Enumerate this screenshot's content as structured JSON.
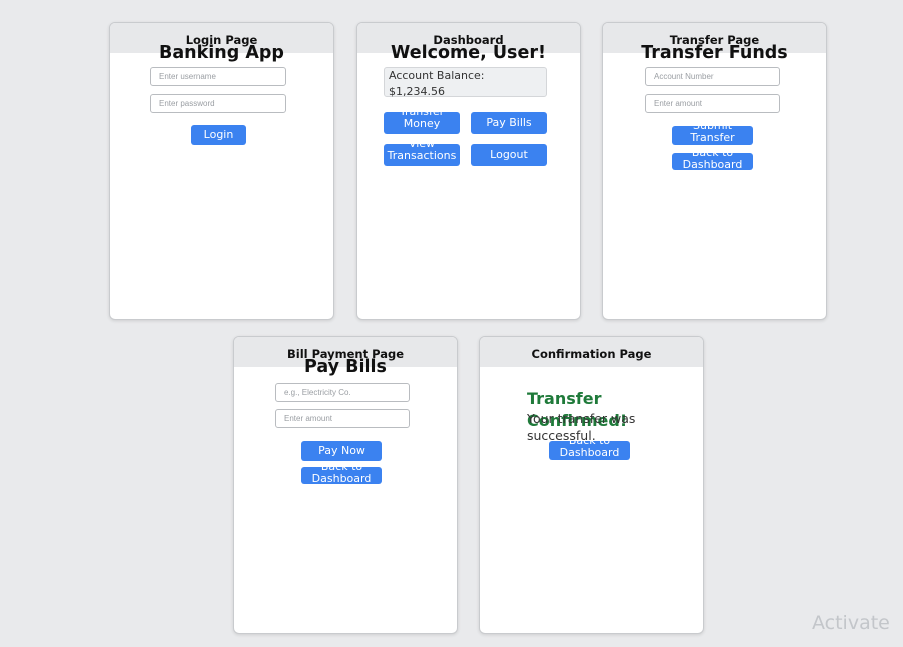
{
  "login": {
    "page_label": "Login Page",
    "heading": "Banking App",
    "username_placeholder": "Enter username",
    "password_placeholder": "Enter password",
    "login_button": "Login"
  },
  "dashboard": {
    "page_label": "Dashboard",
    "heading": "Welcome, User!",
    "balance_label": "Account Balance:",
    "balance_value": "$1,234.56",
    "transfer_button": "Transfer Money",
    "pay_bills_button": "Pay Bills",
    "transactions_button": "View Transactions",
    "logout_button": "Logout"
  },
  "transfer": {
    "page_label": "Transfer Page",
    "heading": "Transfer Funds",
    "account_placeholder": "Account Number",
    "amount_placeholder": "Enter amount",
    "submit_button": "Submit Transfer",
    "back_button": "Back to Dashboard"
  },
  "bill_payment": {
    "page_label": "Bill Payment Page",
    "heading": "Pay Bills",
    "biller_placeholder": "e.g., Electricity Co.",
    "amount_placeholder": "Enter amount",
    "pay_button": "Pay Now",
    "back_button": "Back to Dashboard"
  },
  "confirmation": {
    "page_label": "Confirmation Page",
    "title": "Transfer Confirmed!",
    "message": "Your transfer was successful.",
    "back_button": "Back to Dashboard"
  },
  "watermark": "Activate"
}
